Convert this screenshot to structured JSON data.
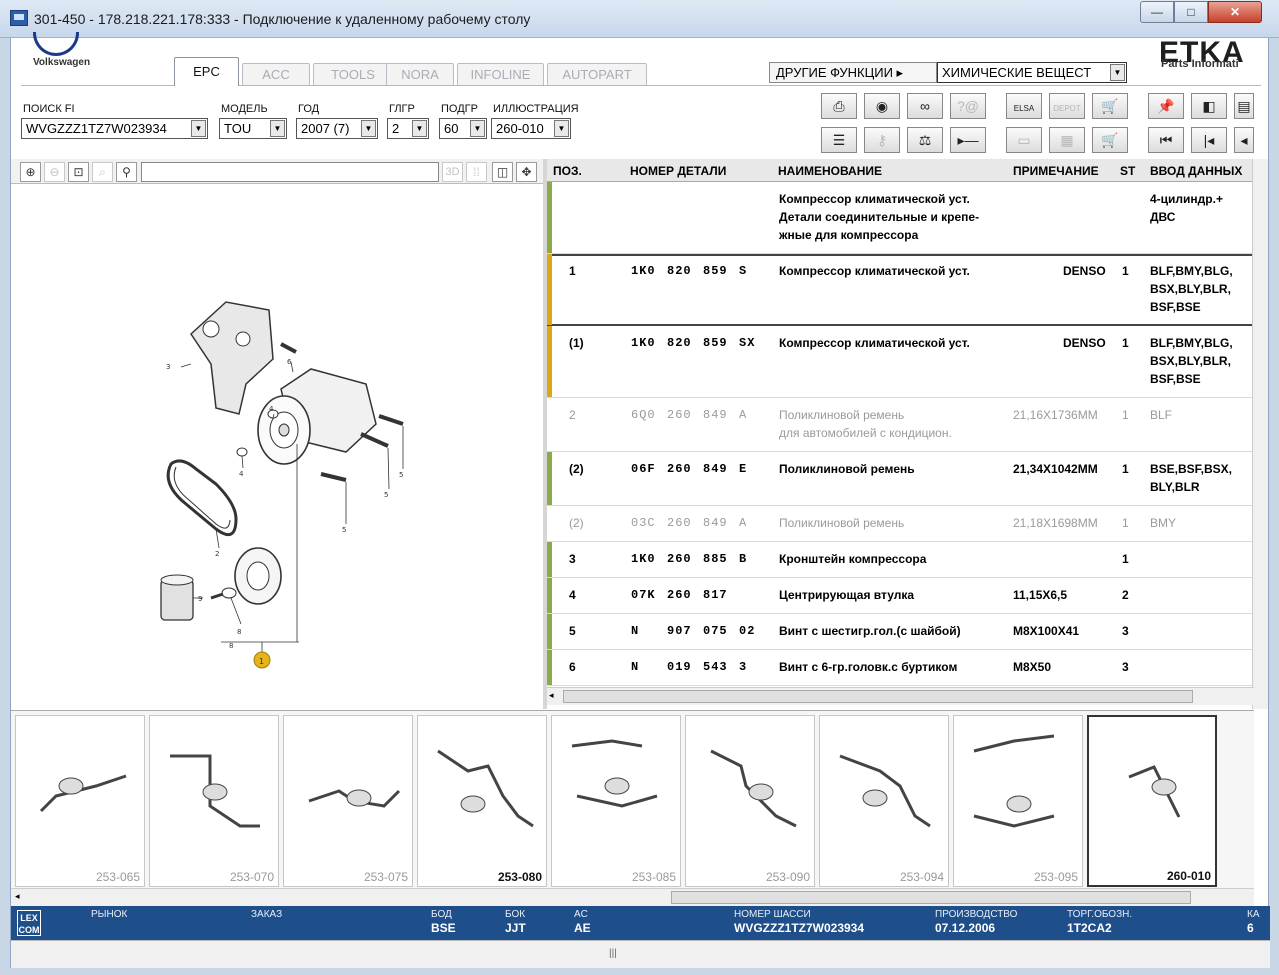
{
  "window": {
    "title": "301-450 - 178.218.221.178:333 - Подключение к удаленному рабочему столу"
  },
  "brand": {
    "vw_label": "Volkswagen",
    "etka_logo": "ETKA",
    "etka_sub": "Parts Informati"
  },
  "tabs": [
    {
      "label": "EPC",
      "active": true
    },
    {
      "label": "ACC",
      "active": false
    },
    {
      "label": "TOOLS",
      "active": false
    },
    {
      "label": "NORA",
      "active": false
    },
    {
      "label": "INFOLINE",
      "active": false
    },
    {
      "label": "AUTOPART",
      "active": false
    }
  ],
  "other_functions": {
    "label": "ДРУГИЕ ФУНКЦИИ ▸",
    "selected": "ХИМИЧЕСКИЕ ВЕЩЕСТ"
  },
  "filters": {
    "search_fi": {
      "label": "ПОИСК FI",
      "value": "WVGZZZ1TZ7W023934"
    },
    "model": {
      "label": "МОДЕЛЬ",
      "value": "TOU"
    },
    "year": {
      "label": "ГОД",
      "value": "2007 (7)"
    },
    "main_group": {
      "label": "ГЛГР",
      "value": "2"
    },
    "sub_group": {
      "label": "ПОДГР",
      "value": "60"
    },
    "illustration": {
      "label": "ИЛЛЮСТРАЦИЯ",
      "value": "260-010"
    }
  },
  "toolbar": {
    "row1": [
      "print",
      "cd",
      "binoculars",
      "help",
      "elsa",
      "depot",
      "cart-add",
      "pin",
      "page-prev",
      "page"
    ],
    "row2": [
      "list",
      "key",
      "scale",
      "play-minus",
      "monitor",
      "calc",
      "cart",
      "first",
      "prev",
      "back"
    ],
    "elsa_label": "ELSA",
    "depot_label": "DEPOT"
  },
  "illus_toolbar": {
    "three_d": "3D"
  },
  "table": {
    "headers": {
      "pos": "ПОЗ.",
      "part_no": "НОМЕР ДЕТАЛИ",
      "name": "НАИМЕНОВАНИЕ",
      "note": "ПРИМЕЧАНИЕ",
      "st": "ST",
      "input": "ВВОД ДАННЫХ"
    },
    "rows": [
      {
        "pos": "",
        "p1": "",
        "p2": "",
        "p3": "",
        "p4": "",
        "name": "Компрессор климатической уст.\nДетали соединительные и крепе-\nжные для компрессора",
        "note": "",
        "st": "",
        "input": "4-цилиндр.+\nДВС",
        "bar": "#8bab4a",
        "grey": false
      },
      {
        "pos": "1",
        "p1": "1K0",
        "p2": "820",
        "p3": "859",
        "p4": "S",
        "name": "Компрессор климатической уст.",
        "note": "DENSO",
        "st": "1",
        "input": "BLF,BMY,BLG,\nBSX,BLY,BLR,\nBSF,BSE",
        "bar": "#e0a619",
        "grey": false,
        "selected": true
      },
      {
        "pos": "(1)",
        "p1": "1K0",
        "p2": "820",
        "p3": "859",
        "p4": "SX",
        "name": "Компрессор климатической уст.",
        "note": "DENSO",
        "st": "1",
        "input": "BLF,BMY,BLG,\nBSX,BLY,BLR,\nBSF,BSE",
        "bar": "#e0a619",
        "grey": false
      },
      {
        "pos": "2",
        "p1": "6Q0",
        "p2": "260",
        "p3": "849",
        "p4": "A",
        "name": "Поликлиновой ремень\nдля автомобилей с кондицион.",
        "note": "21,16X1736MM",
        "st": "1",
        "input": "BLF",
        "bar": "",
        "grey": true
      },
      {
        "pos": "(2)",
        "p1": "06F",
        "p2": "260",
        "p3": "849",
        "p4": "E",
        "name": "Поликлиновой ремень",
        "note": "21,34X1042MM",
        "st": "1",
        "input": "BSE,BSF,BSX,\nBLY,BLR",
        "bar": "#8bab4a",
        "grey": false
      },
      {
        "pos": "(2)",
        "p1": "03C",
        "p2": "260",
        "p3": "849",
        "p4": "A",
        "name": "Поликлиновой ремень",
        "note": "21,18X1698MM",
        "st": "1",
        "input": "BMY",
        "bar": "",
        "grey": true
      },
      {
        "pos": "3",
        "p1": "1K0",
        "p2": "260",
        "p3": "885",
        "p4": "B",
        "name": "Кронштейн компрессора",
        "note": "",
        "st": "1",
        "input": "",
        "bar": "#8bab4a",
        "grey": false
      },
      {
        "pos": "4",
        "p1": "07K",
        "p2": "260",
        "p3": "817",
        "p4": "",
        "name": "Центрирующая втулка",
        "note": "11,15X6,5",
        "st": "2",
        "input": "",
        "bar": "#8bab4a",
        "grey": false
      },
      {
        "pos": "5",
        "p1": "N",
        "p2": "907",
        "p3": "075",
        "p4": "02",
        "name": "Винт с шестигр.гол.(с шайбой)",
        "note": "M8X100X41",
        "st": "3",
        "input": "",
        "bar": "#8bab4a",
        "grey": false
      },
      {
        "pos": "6",
        "p1": "N",
        "p2": "019",
        "p3": "543",
        "p4": "3",
        "name": "Винт с 6-гр.головк.с буртиком",
        "note": "M8X50",
        "st": "3",
        "input": "",
        "bar": "#8bab4a",
        "grey": false
      }
    ]
  },
  "illustration_callouts": [
    "3",
    "6",
    "4",
    "4",
    "5",
    "5",
    "5",
    "2",
    "9",
    "8",
    "8",
    "1"
  ],
  "thumbnails": [
    {
      "label": "253-065",
      "active": false
    },
    {
      "label": "253-070",
      "active": false
    },
    {
      "label": "253-075",
      "active": false
    },
    {
      "label": "253-080",
      "active": false,
      "bold": true
    },
    {
      "label": "253-085",
      "active": false
    },
    {
      "label": "253-090",
      "active": false
    },
    {
      "label": "253-094",
      "active": false
    },
    {
      "label": "253-095",
      "active": false
    },
    {
      "label": "260-010",
      "active": true
    }
  ],
  "status": {
    "lexcom": "LEX\nCOM",
    "market": {
      "label": "РЫНОК",
      "value": ""
    },
    "order": {
      "label": "ЗАКАЗ",
      "value": ""
    },
    "bod": {
      "label": "БОД",
      "value": "BSE"
    },
    "bok": {
      "label": "БОК",
      "value": "JJT"
    },
    "ac": {
      "label": "AC",
      "value": "AE"
    },
    "chassis": {
      "label": "НОМЕР ШАССИ",
      "value": "WVGZZZ1TZ7W023934"
    },
    "production": {
      "label": "ПРОИЗВОДСТВО",
      "value": "07.12.2006"
    },
    "trade": {
      "label": "ТОРГ.ОБОЗН.",
      "value": "1T2CA2"
    },
    "extra": {
      "label": "КА",
      "value": "6"
    }
  }
}
